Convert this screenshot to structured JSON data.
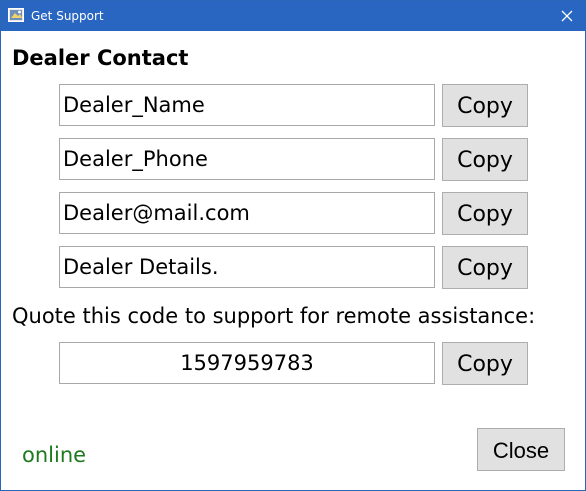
{
  "window": {
    "title": "Get Support",
    "titlebar_color": "#2866c2"
  },
  "dealer": {
    "heading": "Dealer Contact",
    "fields": [
      {
        "value": "Dealer_Name",
        "copy_label": "Copy"
      },
      {
        "value": "Dealer_Phone",
        "copy_label": "Copy"
      },
      {
        "value": "Dealer@mail.com",
        "copy_label": "Copy"
      },
      {
        "value": "Dealer Details.",
        "copy_label": "Copy"
      }
    ]
  },
  "support": {
    "prompt": "Quote this code to support for remote assistance:",
    "code": "1597959783",
    "copy_label": "Copy"
  },
  "footer": {
    "status": "online",
    "status_color": "#1e7a1e",
    "close_label": "Close"
  },
  "icons": [
    "app-icon",
    "close-icon"
  ]
}
